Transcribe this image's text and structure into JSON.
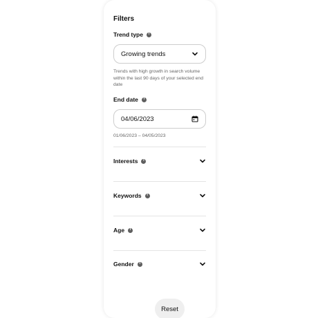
{
  "filters": {
    "title": "Filters",
    "trend_type": {
      "label": "Trend type",
      "selected": "Growing trends",
      "help": "Trends with high growth in search volume within the last 90 days of your selected end date"
    },
    "end_date": {
      "label": "End date",
      "value": "04/06/2023",
      "range": "01/06/2023 – 04/05/2023"
    },
    "sections": [
      {
        "label": "Interests"
      },
      {
        "label": "Keywords"
      },
      {
        "label": "Age"
      },
      {
        "label": "Gender"
      }
    ],
    "reset_label": "Reset",
    "info_glyph": "i"
  },
  "icons": {
    "info": "info-icon",
    "chevron": "chevron-down-icon",
    "calendar": "calendar-icon"
  }
}
